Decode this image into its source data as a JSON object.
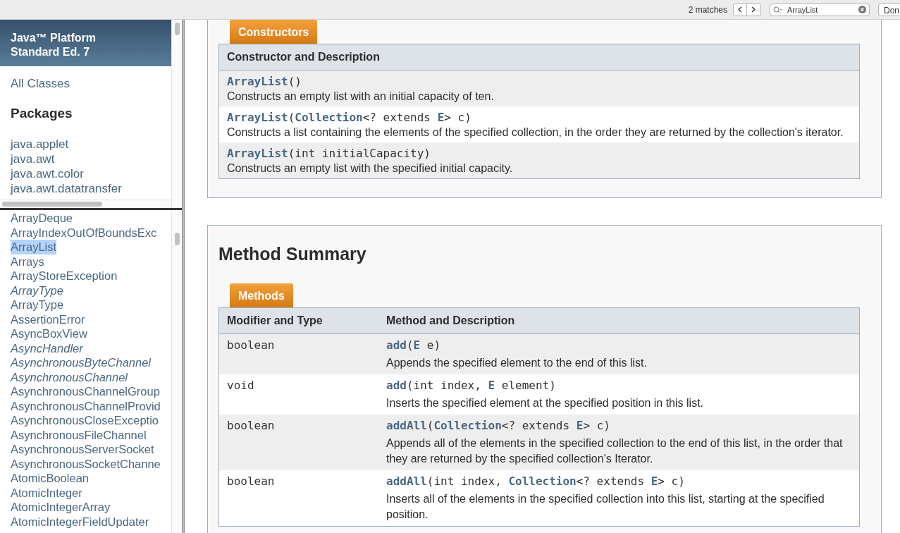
{
  "find_bar": {
    "match_count": "2 matches",
    "search": {
      "value": "ArrayList"
    },
    "done_button": "Don"
  },
  "sidebar": {
    "title_lines": [
      "Java™ Platform",
      "Standard Ed. 7"
    ],
    "all_classes": "All Classes",
    "packages_heading": "Packages",
    "packages": [
      "java.applet",
      "java.awt",
      "java.awt.color",
      "java.awt.datatransfer"
    ],
    "classes": [
      {
        "name": "ArrayDeque",
        "italic": false,
        "selected": false
      },
      {
        "name": "ArrayIndexOutOfBoundsExc",
        "italic": false,
        "selected": false
      },
      {
        "name": "ArrayList",
        "italic": false,
        "selected": true
      },
      {
        "name": "Arrays",
        "italic": false,
        "selected": false
      },
      {
        "name": "ArrayStoreException",
        "italic": false,
        "selected": false
      },
      {
        "name": "ArrayType",
        "italic": true,
        "selected": false
      },
      {
        "name": "ArrayType",
        "italic": false,
        "selected": false
      },
      {
        "name": "AssertionError",
        "italic": false,
        "selected": false
      },
      {
        "name": "AsyncBoxView",
        "italic": false,
        "selected": false
      },
      {
        "name": "AsyncHandler",
        "italic": true,
        "selected": false
      },
      {
        "name": "AsynchronousByteChannel",
        "italic": true,
        "selected": false
      },
      {
        "name": "AsynchronousChannel",
        "italic": true,
        "selected": false
      },
      {
        "name": "AsynchronousChannelGroup",
        "italic": false,
        "selected": false
      },
      {
        "name": "AsynchronousChannelProvid",
        "italic": false,
        "selected": false
      },
      {
        "name": "AsynchronousCloseExceptio",
        "italic": false,
        "selected": false
      },
      {
        "name": "AsynchronousFileChannel",
        "italic": false,
        "selected": false
      },
      {
        "name": "AsynchronousServerSocket",
        "italic": false,
        "selected": false
      },
      {
        "name": "AsynchronousSocketChanne",
        "italic": false,
        "selected": false
      },
      {
        "name": "AtomicBoolean",
        "italic": false,
        "selected": false
      },
      {
        "name": "AtomicInteger",
        "italic": false,
        "selected": false
      },
      {
        "name": "AtomicIntegerArray",
        "italic": false,
        "selected": false
      },
      {
        "name": "AtomicIntegerFieldUpdater",
        "italic": false,
        "selected": false
      }
    ]
  },
  "constructors": {
    "tab": "Constructors",
    "column": "Constructor and Description",
    "rows": [
      {
        "signature": "**ArrayList**()",
        "description": "Constructs an empty list with an initial capacity of ten."
      },
      {
        "signature": "**ArrayList**(**Collection**<? extends **E**> c)",
        "description": "Constructs a list containing the elements of the specified collection, in the order they are returned by the collection's iterator."
      },
      {
        "signature": "**ArrayList**(int initialCapacity)",
        "description": "Constructs an empty list with the specified initial capacity."
      }
    ]
  },
  "method_summary": {
    "heading": "Method Summary",
    "tab": "Methods",
    "columns": [
      "Modifier and Type",
      "Method and Description"
    ],
    "rows": [
      {
        "type": "boolean",
        "signature": "**add**(**E** e)",
        "description": "Appends the specified element to the end of this list."
      },
      {
        "type": "void",
        "signature": "**add**(int index, **E** element)",
        "description": "Inserts the specified element at the specified position in this list."
      },
      {
        "type": "boolean",
        "signature": "**addAll**(**Collection**<? extends **E**> c)",
        "description": "Appends all of the elements in the specified collection to the end of this list, in the order that they are returned by the specified collection's Iterator."
      },
      {
        "type": "boolean",
        "signature": "**addAll**(int index, **Collection**<? extends **E**> c)",
        "description": "Inserts all of the elements in the specified collection into this list, starting at the specified position."
      }
    ]
  }
}
